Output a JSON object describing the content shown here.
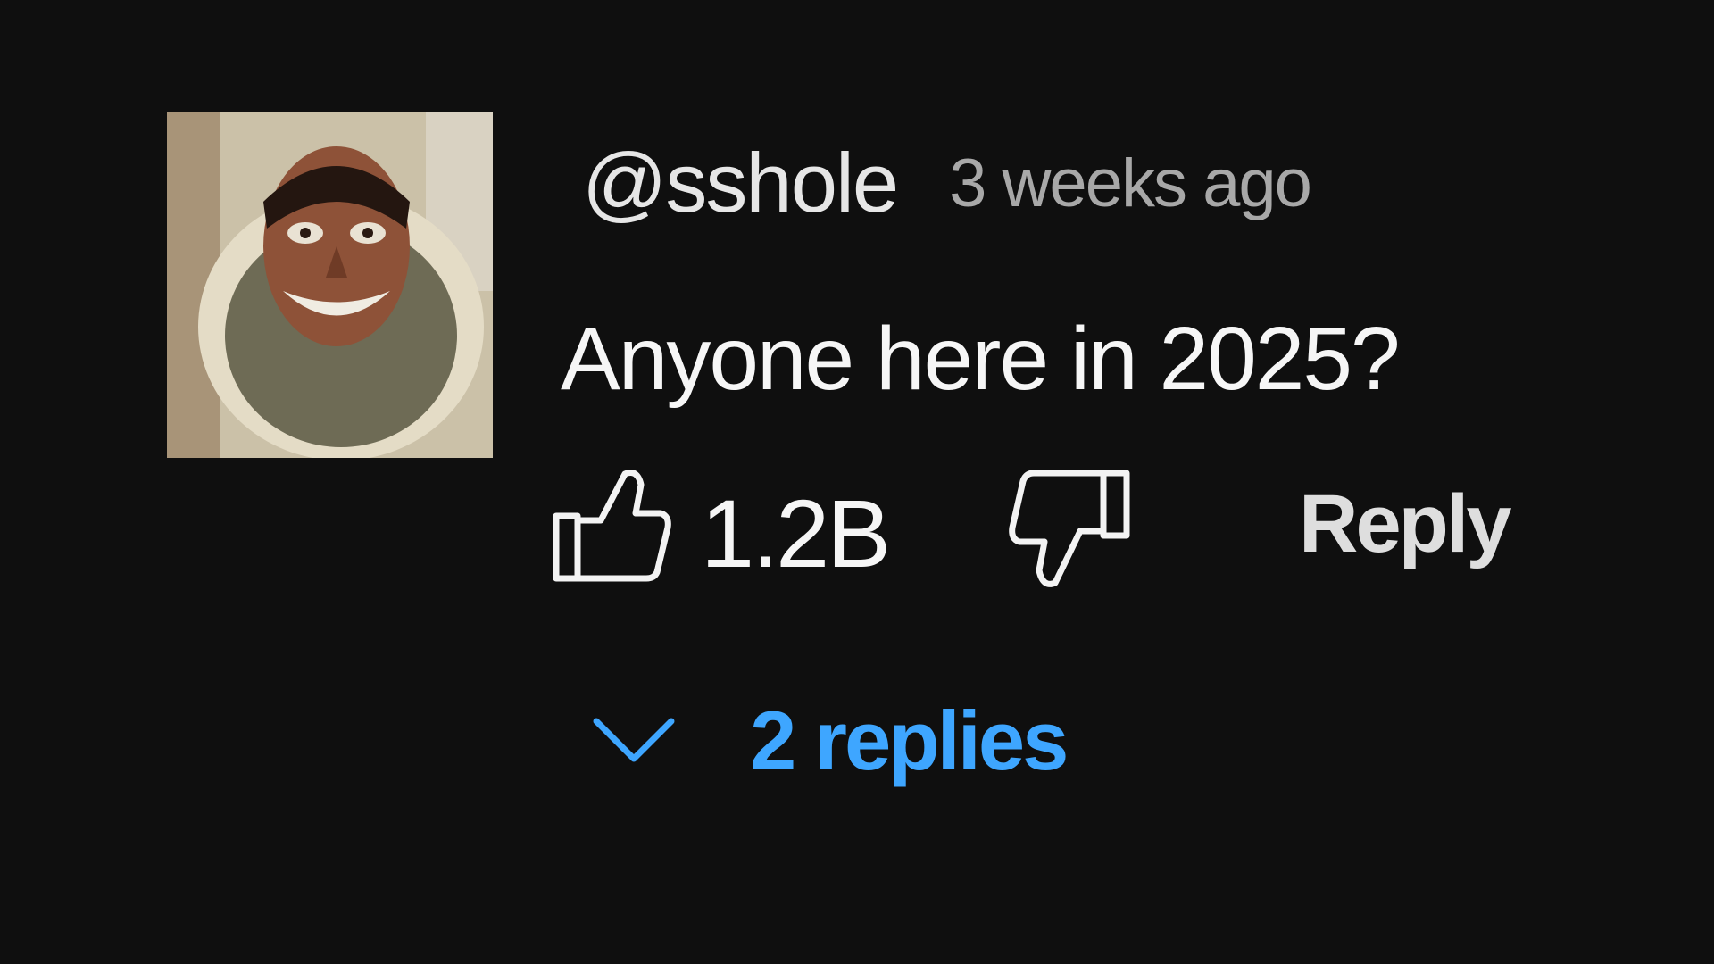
{
  "comment": {
    "author": "@sshole",
    "timestamp": "3 weeks ago",
    "text": "Anyone here in 2025?",
    "like_count": "1.2B",
    "reply_label": "Reply",
    "replies_label": "2 replies"
  },
  "icons": {
    "like": "thumbs-up-icon",
    "dislike": "thumbs-down-icon",
    "expand": "chevron-down-icon"
  },
  "colors": {
    "background": "#0f0f0f",
    "text": "#f1f1f1",
    "muted": "#aaaaaa",
    "accent": "#3ea6ff"
  }
}
